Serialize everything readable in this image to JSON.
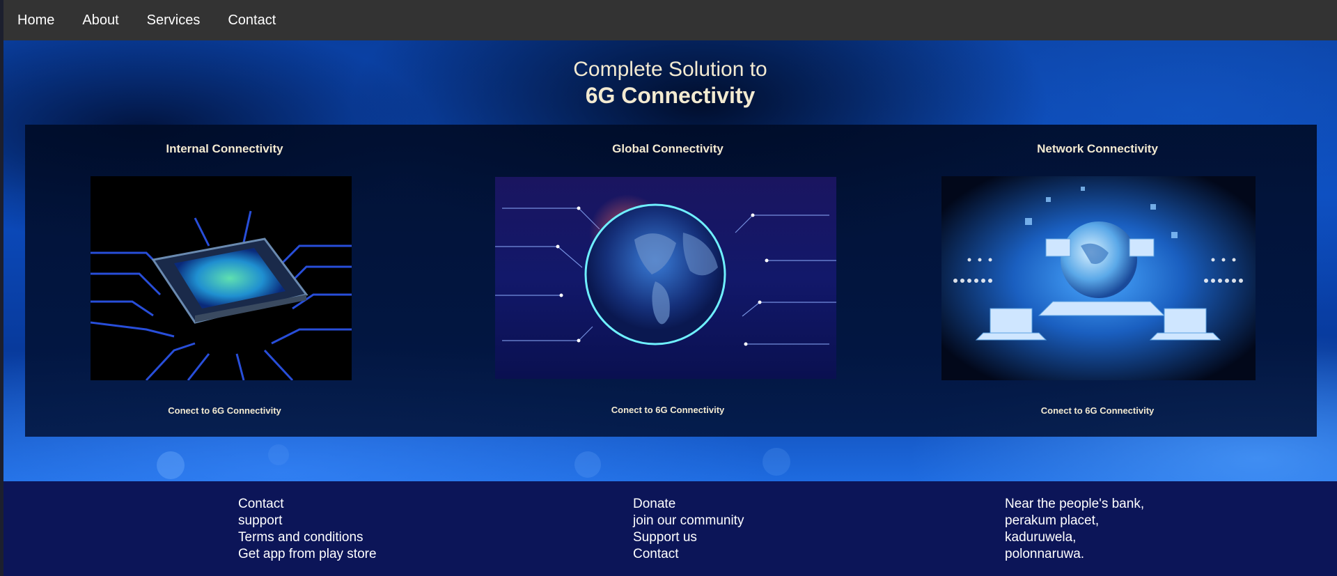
{
  "nav": {
    "items": [
      {
        "label": "Home"
      },
      {
        "label": "About"
      },
      {
        "label": "Services"
      },
      {
        "label": "Contact"
      }
    ]
  },
  "hero": {
    "line1": "Complete Solution to",
    "line2": "6G Connectivity"
  },
  "cards": [
    {
      "title": "Internal Connectivity",
      "image": "circuit-chip-image",
      "link": "Conect to 6G Connectivity"
    },
    {
      "title": "Global Connectivity",
      "image": "glowing-globe-image",
      "link": "Conect to 6G Connectivity"
    },
    {
      "title": "Network Connectivity",
      "image": "network-globe-laptops-image",
      "link": "Conect to 6G Connectivity"
    }
  ],
  "footer": {
    "col1": [
      "Contact",
      "support",
      "Terms and conditions",
      "Get app from play store"
    ],
    "col2": [
      "Donate",
      "join our community",
      "Support us",
      "Contact"
    ],
    "col3": [
      "Near the people's bank,",
      "perakum placet,",
      "kaduruwela,",
      "polonnaruwa."
    ]
  },
  "colors": {
    "nav_bg": "#333333",
    "footer_bg": "#0c1558",
    "title_text": "#f3ead1"
  }
}
